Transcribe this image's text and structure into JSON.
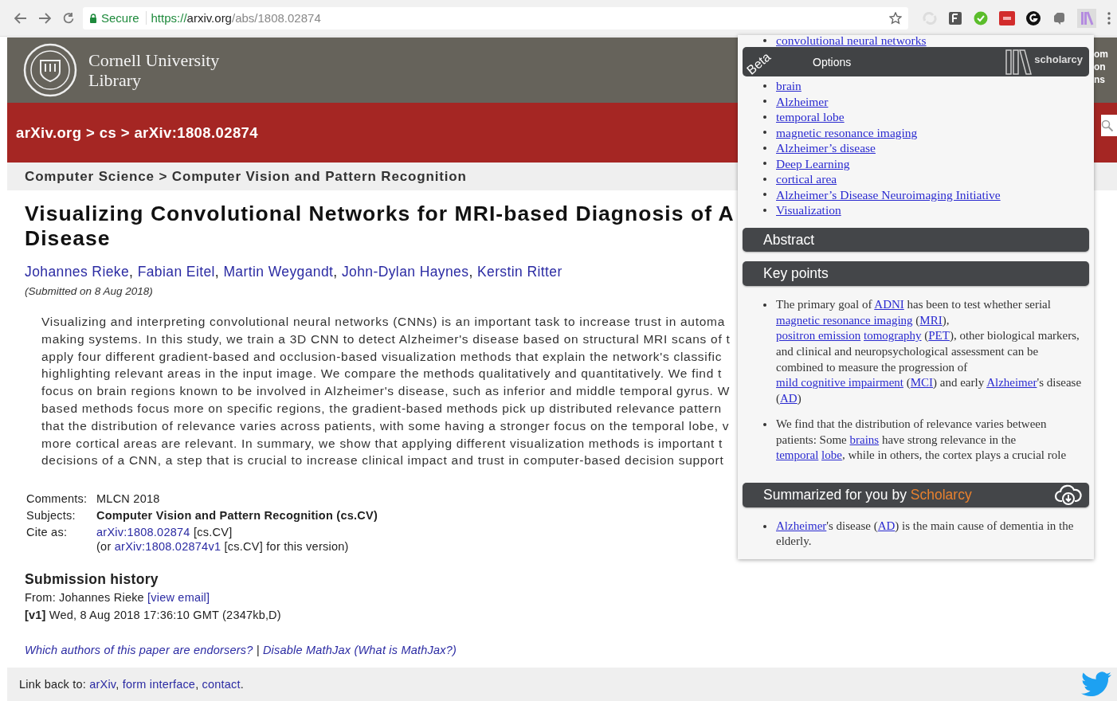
{
  "browser": {
    "secure_label": "Secure",
    "url": [
      {
        "text": "https://",
        "kind": "scheme"
      },
      {
        "text": "arxiv.org",
        "kind": "host"
      },
      {
        "text": "/abs/1808.02874",
        "kind": "path"
      }
    ]
  },
  "header": {
    "logo_lines": [
      "Cornell University",
      "Library"
    ],
    "right_fragments": [
      "om",
      "on",
      "ns"
    ]
  },
  "breadcrumb": {
    "items": [
      "arXiv.org",
      "cs",
      "arXiv:1808.02874"
    ],
    "separator": " > "
  },
  "subject_bar": "Computer Science > Computer Vision and Pattern Recognition",
  "paper": {
    "title_lines": [
      "Visualizing Convolutional Networks for MRI-based Diagnosis of A",
      "Disease"
    ],
    "authors": [
      {
        "text": "Johannes Rieke",
        "kind": "link"
      },
      {
        "text": ", ",
        "kind": "text"
      },
      {
        "text": "Fabian Eitel",
        "kind": "link"
      },
      {
        "text": ", ",
        "kind": "text"
      },
      {
        "text": "Martin Weygandt",
        "kind": "link"
      },
      {
        "text": ", ",
        "kind": "text"
      },
      {
        "text": "John-Dylan Haynes",
        "kind": "link"
      },
      {
        "text": ", ",
        "kind": "text"
      },
      {
        "text": "Kerstin Ritter",
        "kind": "link"
      }
    ],
    "submitted": "(Submitted on 8 Aug 2018)",
    "abstract_lines": [
      "Visualizing and interpreting convolutional neural networks (CNNs) is an important task to increase trust in automa",
      "making systems. In this study, we train a 3D CNN to detect Alzheimer's disease based on structural MRI scans of t",
      "apply four different gradient-based and occlusion-based visualization methods that explain the network's classific",
      "highlighting relevant areas in the input image. We compare the methods qualitatively and quantitatively. We find t",
      "focus on brain regions known to be involved in Alzheimer's disease, such as inferior and middle temporal gyrus. W",
      "based methods focus more on specific regions, the gradient-based methods pick up distributed relevance pattern",
      "that the distribution of relevance varies across patients, with some having a stronger focus on the temporal lobe, v",
      "more cortical areas are relevant. In summary, we show that applying different visualization methods is important t",
      "decisions of a CNN, a step that is crucial to increase clinical impact and trust in computer-based decision support"
    ],
    "metadata": [
      {
        "label": "Comments:",
        "kind": "plain",
        "lines": [
          [
            {
              "text": "MLCN 2018",
              "kind": "text"
            }
          ]
        ]
      },
      {
        "label": "Subjects:",
        "kind": "bold",
        "lines": [
          [
            {
              "text": "Computer Vision and Pattern Recognition (cs.CV)",
              "kind": "text"
            }
          ]
        ]
      },
      {
        "label": "Cite as:",
        "kind": "plain",
        "lines": [
          [
            {
              "text": "arXiv:1808.02874",
              "kind": "link"
            },
            {
              "text": " [cs.CV]",
              "kind": "text"
            }
          ],
          [
            {
              "text": "(or ",
              "kind": "text"
            },
            {
              "text": "arXiv:1808.02874v1",
              "kind": "link"
            },
            {
              "text": " [cs.CV] for this version)",
              "kind": "text"
            }
          ]
        ]
      }
    ],
    "history_title": "Submission history",
    "history": [
      [
        {
          "text": "From: Johannes Rieke ",
          "kind": "text"
        },
        {
          "text": "[view email]",
          "kind": "link"
        }
      ],
      [
        {
          "text": "**[v1]** Wed, 8 Aug 2018 17:36:10 GMT (2347kb,D)",
          "kind": "text"
        }
      ]
    ],
    "endorser_links": [
      {
        "text": "Which authors of this paper are endorsers?",
        "kind": "link"
      },
      {
        "text": " | ",
        "kind": "text"
      },
      {
        "text": "Disable MathJax",
        "kind": "link"
      },
      {
        "text": "(What is MathJax?)",
        "kind": "link"
      }
    ]
  },
  "footer": [
    {
      "text": "Link back to: ",
      "kind": "text"
    },
    {
      "text": "arXiv",
      "kind": "link"
    },
    {
      "text": ", ",
      "kind": "text"
    },
    {
      "text": "form interface",
      "kind": "link"
    },
    {
      "text": ", ",
      "kind": "text"
    },
    {
      "text": "contact",
      "kind": "link"
    },
    {
      "text": ".",
      "kind": "text"
    }
  ],
  "scholarcy": {
    "badge": "Beta",
    "options_label": "Options",
    "logo_text": "scholarcy",
    "top_keyword": "convolutional neural networks",
    "keywords": [
      "brain",
      "Alzheimer",
      "temporal lobe",
      "magnetic resonance imaging",
      "Alzheimer’s disease",
      "Deep Learning",
      "cortical area",
      "Alzheimer’s Disease Neuroimaging Initiative",
      "Visualization"
    ],
    "sections": [
      {
        "title": "Abstract",
        "kind": "plain"
      },
      {
        "title": "Key points",
        "kind": "plain",
        "bullets": [
          [
            {
              "text": "The primary goal of ",
              "kind": "text"
            },
            {
              "text": "ADNI",
              "kind": "link"
            },
            {
              "text": " has been to test whether serial ",
              "kind": "text"
            },
            {
              "text": "magnetic resonance imaging",
              "kind": "link"
            },
            {
              "text": " (",
              "kind": "text"
            },
            {
              "text": "MRI",
              "kind": "link"
            },
            {
              "text": "), ",
              "kind": "text"
            },
            {
              "text": "positron emission",
              "kind": "link"
            },
            {
              "text": "tomography",
              "kind": "link"
            },
            {
              "text": " (",
              "kind": "text"
            },
            {
              "text": "PET",
              "kind": "link"
            },
            {
              "text": "), other biological markers, and clinical and neuropsychological assessment can be combined to measure the progression of ",
              "kind": "text"
            },
            {
              "text": "mild cognitive impairment",
              "kind": "link"
            },
            {
              "text": " (",
              "kind": "text"
            },
            {
              "text": "MCI",
              "kind": "link"
            },
            {
              "text": ") and early ",
              "kind": "text"
            },
            {
              "text": "Alzheimer",
              "kind": "link"
            },
            {
              "text": "'s disease (",
              "kind": "text"
            },
            {
              "text": "AD",
              "kind": "link"
            },
            {
              "text": ")",
              "kind": "text"
            }
          ],
          [
            {
              "text": "We find that the distribution of relevance varies between patients: Some ",
              "kind": "text"
            },
            {
              "text": "brains",
              "kind": "link"
            },
            {
              "text": " have strong relevance in the ",
              "kind": "text"
            },
            {
              "text": "temporal",
              "kind": "link"
            },
            {
              "text": "lobe",
              "kind": "link"
            },
            {
              "text": ", while in others, the cortex plays a crucial role",
              "kind": "text"
            }
          ]
        ]
      },
      {
        "title": "Summarized for you by ",
        "brand": "Scholarcy",
        "kind": "download",
        "bullets": [
          [
            {
              "text": "Alzheimer",
              "kind": "link"
            },
            {
              "text": "'s disease (",
              "kind": "text"
            },
            {
              "text": "AD",
              "kind": "link"
            },
            {
              "text": ") is the main cause of dementia in the elderly.",
              "kind": "text"
            }
          ]
        ]
      }
    ]
  }
}
